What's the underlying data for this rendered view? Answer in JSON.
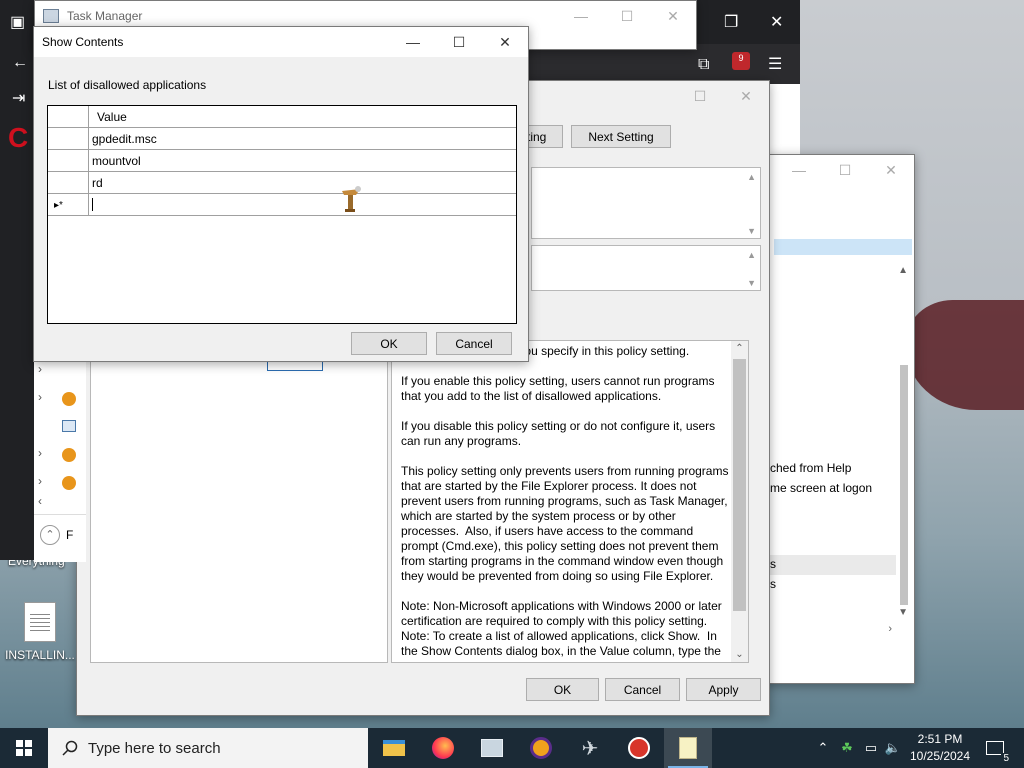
{
  "desktop": {
    "everything_label": "Everything",
    "installer_label": "INSTALLIN..."
  },
  "taskmgr": {
    "title": "Task Manager"
  },
  "browser": {
    "badge_count": "9"
  },
  "right_window": {
    "line1": "ched from Help",
    "line2": "me screen at logon",
    "line3": "s",
    "line4": "s"
  },
  "policy": {
    "prev_setting": "tting",
    "next_setting": "Next Setting",
    "help_text": "running the programs you specify in this policy setting.\n\nIf you enable this policy setting, users cannot run programs that you add to the list of disallowed applications.\n\nIf you disable this policy setting or do not configure it, users can run any programs.\n\nThis policy setting only prevents users from running programs that are started by the File Explorer process. It does not prevent users from running programs, such as Task Manager, which are started by the system process or by other processes.  Also, if users have access to the command prompt (Cmd.exe), this policy setting does not prevent them from starting programs in the command window even though they would be prevented from doing so using File Explorer.\n\nNote: Non-Microsoft applications with Windows 2000 or later certification are required to comply with this policy setting.\nNote: To create a list of allowed applications, click Show.  In the Show Contents dialog box, in the Value column, type the",
    "ok": "OK",
    "cancel": "Cancel",
    "apply": "Apply",
    "tree_bottom_label": "F"
  },
  "show_contents": {
    "title": "Show Contents",
    "list_label": "List of disallowed applications",
    "column_header": "Value",
    "values": [
      "gpdedit.msc",
      "mountvol",
      "rd"
    ],
    "new_row_marker": "▸*",
    "ok": "OK",
    "cancel": "Cancel"
  },
  "taskbar": {
    "search_placeholder": "Type here to search",
    "time": "2:51 PM",
    "date": "10/25/2024",
    "notifications_count": "5"
  },
  "icons": {
    "start": "windows-logo-icon",
    "search": "search-icon",
    "apps": [
      "file-explorer-icon",
      "firefox-icon",
      "photos-icon",
      "brave-shield-icon",
      "plane-icon",
      "paint-icon",
      "notepad-icon"
    ],
    "tray": [
      "chevron-up-icon",
      "clover-icon",
      "network-icon",
      "volume-icon"
    ]
  }
}
